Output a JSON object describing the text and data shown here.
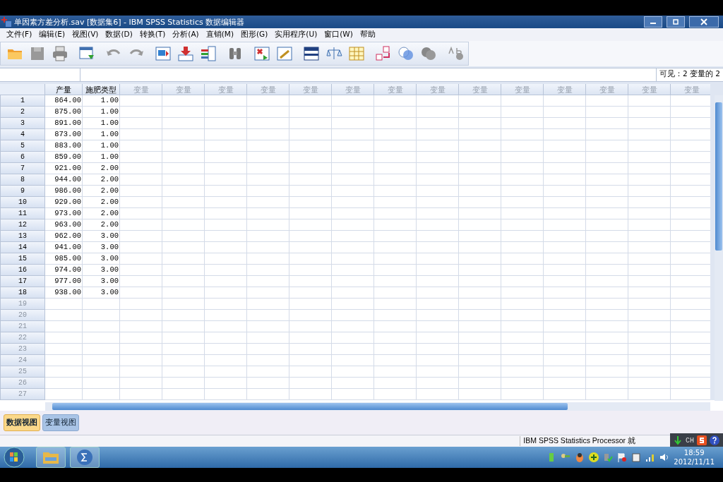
{
  "window": {
    "title": "单因素方差分析.sav [数据集6] - IBM SPSS Statistics 数据编辑器"
  },
  "menu": [
    "文件(F)",
    "编辑(E)",
    "视图(V)",
    "数据(D)",
    "转换(T)",
    "分析(A)",
    "直销(M)",
    "图形(G)",
    "实用程序(U)",
    "窗口(W)",
    "帮助"
  ],
  "visible_label": "可见：2 变量的 2",
  "columns": [
    {
      "label": "产量",
      "kind": "defined"
    },
    {
      "label": "施肥类型",
      "kind": "defined"
    },
    {
      "label": "变量",
      "kind": "empty"
    },
    {
      "label": "变量",
      "kind": "empty"
    },
    {
      "label": "变量",
      "kind": "empty"
    },
    {
      "label": "变量",
      "kind": "empty"
    },
    {
      "label": "变量",
      "kind": "empty"
    },
    {
      "label": "变量",
      "kind": "empty"
    },
    {
      "label": "变量",
      "kind": "empty"
    },
    {
      "label": "变量",
      "kind": "empty"
    },
    {
      "label": "变量",
      "kind": "empty"
    },
    {
      "label": "变量",
      "kind": "empty"
    },
    {
      "label": "变量",
      "kind": "empty"
    },
    {
      "label": "变量",
      "kind": "empty"
    },
    {
      "label": "变量",
      "kind": "empty"
    },
    {
      "label": "变量",
      "kind": "empty"
    }
  ],
  "rows": [
    {
      "number": "1",
      "cells": [
        "864.00",
        "1.00"
      ]
    },
    {
      "number": "2",
      "cells": [
        "875.00",
        "1.00"
      ]
    },
    {
      "number": "3",
      "cells": [
        "891.00",
        "1.00"
      ]
    },
    {
      "number": "4",
      "cells": [
        "873.00",
        "1.00"
      ]
    },
    {
      "number": "5",
      "cells": [
        "883.00",
        "1.00"
      ]
    },
    {
      "number": "6",
      "cells": [
        "859.00",
        "1.00"
      ]
    },
    {
      "number": "7",
      "cells": [
        "921.00",
        "2.00"
      ]
    },
    {
      "number": "8",
      "cells": [
        "944.00",
        "2.00"
      ]
    },
    {
      "number": "9",
      "cells": [
        "986.00",
        "2.00"
      ]
    },
    {
      "number": "10",
      "cells": [
        "929.00",
        "2.00"
      ]
    },
    {
      "number": "11",
      "cells": [
        "973.00",
        "2.00"
      ]
    },
    {
      "number": "12",
      "cells": [
        "963.00",
        "2.00"
      ]
    },
    {
      "number": "13",
      "cells": [
        "962.00",
        "3.00"
      ]
    },
    {
      "number": "14",
      "cells": [
        "941.00",
        "3.00"
      ]
    },
    {
      "number": "15",
      "cells": [
        "985.00",
        "3.00"
      ]
    },
    {
      "number": "16",
      "cells": [
        "974.00",
        "3.00"
      ]
    },
    {
      "number": "17",
      "cells": [
        "977.00",
        "3.00"
      ]
    },
    {
      "number": "18",
      "cells": [
        "938.00",
        "3.00"
      ]
    },
    {
      "number": "19",
      "cells": []
    },
    {
      "number": "20",
      "cells": []
    },
    {
      "number": "21",
      "cells": []
    },
    {
      "number": "22",
      "cells": []
    },
    {
      "number": "23",
      "cells": []
    },
    {
      "number": "24",
      "cells": []
    },
    {
      "number": "25",
      "cells": []
    },
    {
      "number": "26",
      "cells": []
    },
    {
      "number": "27",
      "cells": []
    }
  ],
  "view_tabs": [
    {
      "label": "数据视图",
      "selected": true
    },
    {
      "label": "变量视图",
      "selected": false
    }
  ],
  "status_bar": {
    "processor": "IBM SPSS Statistics Processor 就"
  },
  "language_bar": {
    "label": "CH"
  },
  "clock": {
    "time": "18:59",
    "date": "2012/11/11"
  }
}
